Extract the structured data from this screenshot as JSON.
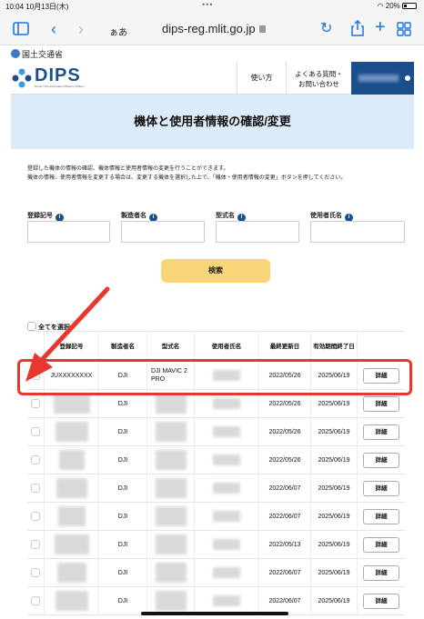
{
  "status": {
    "time": "10:04",
    "date": "10月13日(木)",
    "battery": "20%"
  },
  "browser": {
    "reader": "ぁあ",
    "url": "dips-reg.mlit.go.jp"
  },
  "site": {
    "ministry": "国土交通省",
    "logo_text": "DIPS",
    "logo_sub": "Drone / Info-Information Platform System",
    "nav_howto": "使い方",
    "nav_faq_1": "よくある質問・",
    "nav_faq_2": "お問い合わせ"
  },
  "page": {
    "title": "機体と使用者情報の確認/変更",
    "desc_1": "登録した機体の情報の確認、機体情報と使用者情報の変更を行うことができます。",
    "desc_2": "機体の情報、使用者情報を変更する場合は、変更する機体を選択した上で、「機体・使用者情報の変更」ボタンを押してください。"
  },
  "filters": {
    "reg_no": "登録記号",
    "maker": "製造者名",
    "model": "型式名",
    "user": "使用者氏名",
    "search": "検索",
    "select_all": "全てを選択"
  },
  "table": {
    "headers": [
      "登録記号",
      "製造者名",
      "型式名",
      "使用者氏名",
      "最終更新日",
      "有効期間終了日"
    ],
    "detail_label": "詳細",
    "rows": [
      {
        "reg": "JUXXXXXXXX",
        "maker": "DJI",
        "model": "DJI MAVIC 2 PRO",
        "updated": "2022/05/26",
        "expires": "2025/06/19"
      },
      {
        "reg": "",
        "maker": "DJI",
        "model": "",
        "updated": "2022/05/26",
        "expires": "2025/06/19"
      },
      {
        "reg": "",
        "maker": "DJI",
        "model": "",
        "updated": "2022/05/26",
        "expires": "2025/06/19"
      },
      {
        "reg": "",
        "maker": "DJI",
        "model": "",
        "updated": "2022/05/26",
        "expires": "2025/06/19"
      },
      {
        "reg": "",
        "maker": "DJI",
        "model": "",
        "updated": "2022/06/07",
        "expires": "2025/06/19"
      },
      {
        "reg": "",
        "maker": "DJI",
        "model": "",
        "updated": "2022/06/07",
        "expires": "2025/06/19"
      },
      {
        "reg": "",
        "maker": "DJI",
        "model": "",
        "updated": "2022/05/13",
        "expires": "2025/06/19"
      },
      {
        "reg": "",
        "maker": "DJI",
        "model": "",
        "updated": "2022/06/07",
        "expires": "2025/06/19"
      },
      {
        "reg": "",
        "maker": "DJI",
        "model": "",
        "updated": "2022/06/07",
        "expires": "2025/06/19"
      }
    ]
  },
  "colors": {
    "brand": "#1b4f8c",
    "band": "#dcebf8",
    "search_button": "#f8d576",
    "annotation": "#e8372c"
  }
}
